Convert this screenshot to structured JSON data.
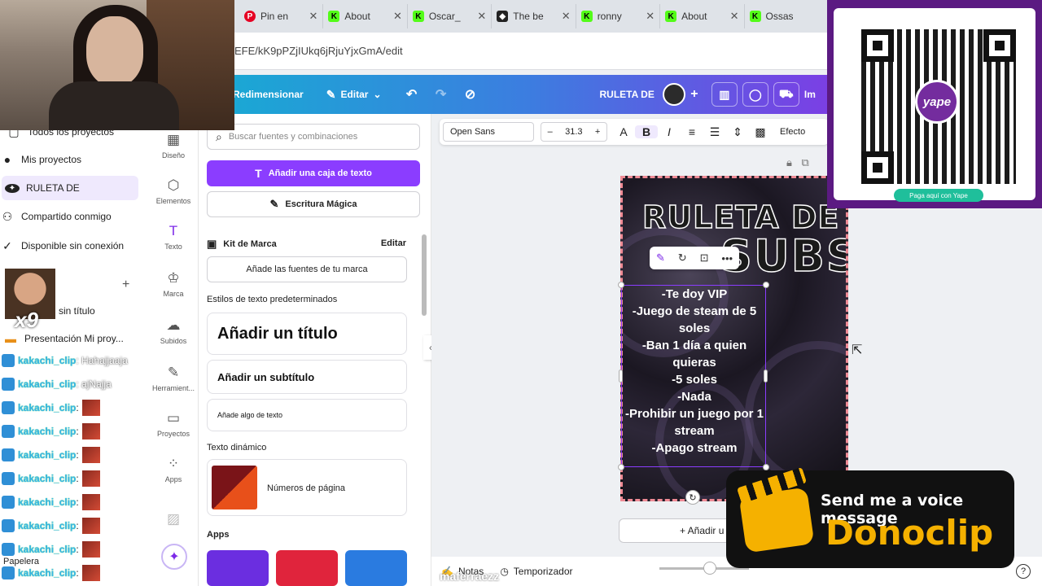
{
  "browser": {
    "tabs": [
      {
        "title": "Pin en",
        "color": "#e60023",
        "glyph": "P"
      },
      {
        "title": "About",
        "color": "#1a1a1a",
        "glyph": "K"
      },
      {
        "title": "Oscar_",
        "color": "#1a1a1a",
        "glyph": "K"
      },
      {
        "title": "The be",
        "color": "#1a1a1a",
        "glyph": "◆"
      },
      {
        "title": "ronny",
        "color": "#1a1a1a",
        "glyph": "K"
      },
      {
        "title": "About",
        "color": "#1a1a1a",
        "glyph": "K"
      },
      {
        "title": "Ossas",
        "color": "#1a1a1a",
        "glyph": "K"
      }
    ],
    "url": "EFE/kK9pPZjIUkq6jRjuYjxGmA/edit"
  },
  "canva_top": {
    "resize": "Redimensionar",
    "edit": "Editar",
    "doc_title": "RULETA DE",
    "share_partial": "Im"
  },
  "projects": {
    "items": [
      {
        "label": "Todos los proyectos"
      },
      {
        "label": "Mis proyectos"
      },
      {
        "label": "RULETA DE"
      },
      {
        "label": "Compartido conmigo"
      },
      {
        "label": "Disponible sin conexión"
      }
    ],
    "untitled": "sin título",
    "presentation": "Presentación Mi proy...",
    "trash": "Papelera"
  },
  "chat": {
    "lines": [
      {
        "user": "kakachi_clip",
        "text": ": Hahajjaaja"
      },
      {
        "user": "kakachi_clip",
        "text": ": ajNajja"
      },
      {
        "user": "kakachi_clip",
        "text": ":"
      },
      {
        "user": "kakachi_clip",
        "text": ":"
      },
      {
        "user": "kakachi_clip",
        "text": ":"
      },
      {
        "user": "kakachi_clip",
        "text": ":"
      },
      {
        "user": "kakachi_clip",
        "text": ":"
      },
      {
        "user": "kakachi_clip",
        "text": ":"
      },
      {
        "user": "kakachi_clip",
        "text": ":"
      },
      {
        "user": "kakachi_clip",
        "text": ":"
      }
    ],
    "multiplier": "x9"
  },
  "rail": {
    "items": [
      {
        "label": "Diseño"
      },
      {
        "label": "Elementos"
      },
      {
        "label": "Texto"
      },
      {
        "label": "Marca"
      },
      {
        "label": "Subidos"
      },
      {
        "label": "Herramient..."
      },
      {
        "label": "Proyectos"
      },
      {
        "label": "Apps"
      }
    ]
  },
  "panel": {
    "search_placeholder": "Buscar fuentes y combinaciones",
    "add_textbox": "Añadir una caja de texto",
    "magic_write": "Escritura Mágica",
    "brand_kit": "Kit de Marca",
    "edit": "Editar",
    "add_brand_fonts": "Añade las fuentes de tu marca",
    "default_styles": "Estilos de texto predeterminados",
    "add_title": "Añadir un título",
    "add_subtitle": "Añadir un subtítulo",
    "add_body": "Añade algo de texto",
    "dynamic_text": "Texto dinámico",
    "page_numbers": "Números de página",
    "apps": "Apps"
  },
  "editor_toolbar": {
    "font": "Open Sans",
    "size": "31.3",
    "effects": "Efecto"
  },
  "design": {
    "title_line1": "RULETA DE",
    "title_line2": "SUBS",
    "list": [
      "-Te doy VIP",
      "-Juego de steam de 5 soles",
      "-Ban 1 día a quien quieras",
      "-5 soles",
      "-Nada",
      "-Prohibir un juego por 1 stream",
      "-Apago stream"
    ]
  },
  "add_page": "+ Añadir u",
  "bottom": {
    "notes": "Notas",
    "timer": "Temporizador"
  },
  "overlays": {
    "yape_logo": "yape",
    "yape_pill": "Paga aquí con Yape",
    "dono_top": "Send me a voice message",
    "dono_brand": "Donoclip",
    "watermark": "maferraezz"
  },
  "colors": {
    "canva_purple": "#8b3dff",
    "yape_purple": "#5b1a82",
    "donoclip_yellow": "#f5b100"
  }
}
